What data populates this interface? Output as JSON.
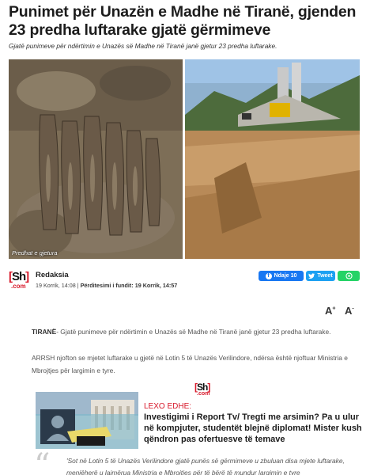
{
  "article": {
    "title": "Punimet për Unazën e Madhe në Tiranë, gjenden 23 predha luftarake gjatë gërmimeve",
    "subtitle": "Gjatë punimeve për ndërtimin e Unazës së Madhe në Tiranë janë gjetur 23 predha luftarake.",
    "image_caption": "Predhat e gjetura",
    "watermark": "shqiptarja.com"
  },
  "byline": {
    "logo_text": "[Sh]",
    "logo_suffix": ".com",
    "author": "Redaksia",
    "published": "19 Korrik, 14:08",
    "updated_label": "Përditesimi i fundit:",
    "updated": "19 Korrik, 14:57"
  },
  "share": {
    "facebook_label": "Ndaje 10",
    "twitter_label": "Tweet",
    "colors": {
      "facebook": "#1877f2",
      "twitter": "#1da1f2",
      "whatsapp": "#25d366"
    }
  },
  "font_controls": {
    "increase": "A",
    "decrease": "A"
  },
  "body": {
    "p1_lead": "TIRANË",
    "p1_text": "- Gjatë punimeve për ndërtimin e Unazës së Madhe në Tiranë janë gjetur 23 predha luftarake.",
    "p2_text": "ARRSH njofton se mjetet luftarake u gjetë në Lotin 5 të Unazës Verilindore, ndërsa është njoftuar Ministria e Mbrojtjes për largimin e tyre."
  },
  "related": {
    "logo_text": "[Sh]",
    "logo_suffix": ".com",
    "label": "LEXO EDHE:",
    "title": "Investigimi i Report Tv/ Tregti me arsimin? Pa u ulur në kompjuter, studentët blejnë diplomat! Mister kush qëndron pas ofertuesve të temave"
  },
  "quote": {
    "text": "'Sot në Lotin 5 të Unazës Verilindore gjatë punës së gërmimeve u zbuluan disa mjete luftarake, menjëherë u lajmërua Ministria e Mbrojtjes për të bërë të mundur largimin e tyre"
  },
  "accent_color": "#d7182a"
}
